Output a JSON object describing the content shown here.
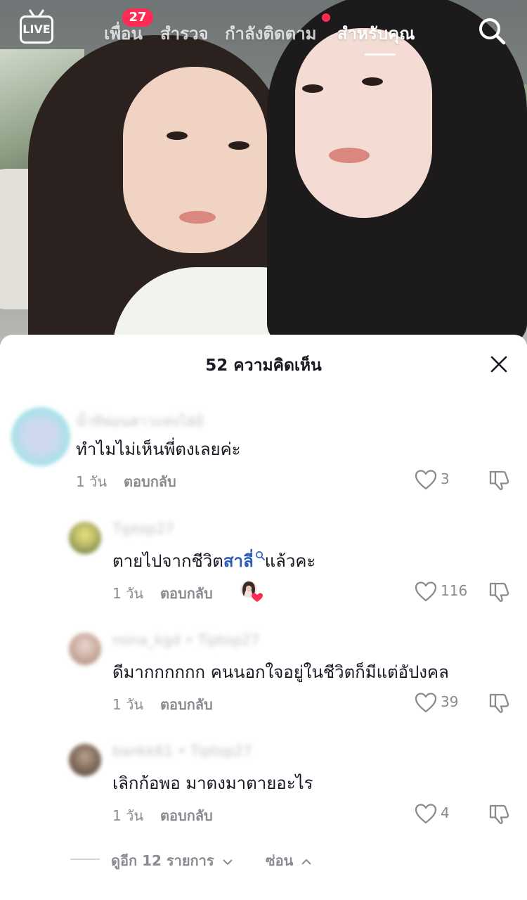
{
  "header": {
    "live_label": "LIVE",
    "tabs": [
      {
        "label": "เพื่อน"
      },
      {
        "label": "สำรวจ"
      },
      {
        "label": "กำลังติดตาม"
      },
      {
        "label": "สำหรับคุณ"
      }
    ],
    "friends_badge": "27",
    "active_tab": "สำหรับคุณ",
    "accent_color": "#fe2c55"
  },
  "comments_sheet": {
    "title": "52 ความคิดเห็น",
    "comments": [
      {
        "text": "ทำไมไม่เห็นพี่ตงเลยค่ะ",
        "username": "น้ำทิพ่อนสาวแท่งไฮ่ย์",
        "age": "1 วัน",
        "reply_label": "ตอบกลับ",
        "likes": "3"
      },
      {
        "text_before": "ตายไปจากชีวิต",
        "mention": "สาลี่",
        "text_after": "แล้วคะ",
        "username": "Tiptop27",
        "age": "1 วัน",
        "reply_label": "ตอบกลับ",
        "likes": "116",
        "liked_by_creator": true
      },
      {
        "text": "ดีมากกกกกก คนนอกใจอยู่ในชีวิตก็มีแต่อัปงคล",
        "username": "nona_kgd • Tiptop27",
        "age": "1 วัน",
        "reply_label": "ตอบกลับ",
        "likes": "39"
      },
      {
        "text": "เลิกก้อพอ มาตงมาตายอะไร",
        "username": "bankk61 • Tiptop27",
        "age": "1 วัน",
        "reply_label": "ตอบกลับ",
        "likes": "4"
      }
    ],
    "view_more_label": "ดูอีก 12 รายการ",
    "hide_label": "ซ่อน"
  }
}
